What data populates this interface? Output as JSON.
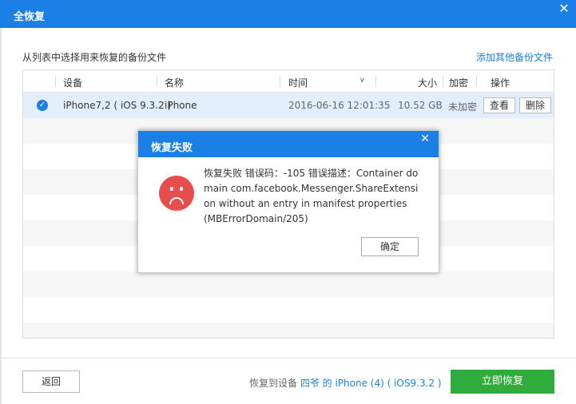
{
  "window": {
    "title": "全恢复",
    "close_glyph": "✕"
  },
  "subtitle": "从列表中选择用来恢复的备份文件",
  "add_link": "添加其他备份文件",
  "table": {
    "headers": {
      "device": "设备",
      "name": "名称",
      "time": "时间",
      "size": "大小",
      "encrypt": "加密",
      "action": "操作"
    },
    "rows": [
      {
        "device": "iPhone7,2 ( iOS 9.3.2 )",
        "name": "iPhone",
        "time": "2016-06-16 12:01:35",
        "size": "10.52 GB",
        "encrypt": "未加密",
        "view_label": "查看",
        "delete_label": "删除",
        "selected": true
      }
    ]
  },
  "footer": {
    "back_label": "返回",
    "restore_to_label": "恢复到设备",
    "device_label": "四爷 的 iPhone (4)  ( iOS9.3.2 )",
    "restore_now_label": "立即恢复"
  },
  "dialog": {
    "title": "恢复失败",
    "close_glyph": "✕",
    "message": "恢复失败 错误码：-105 错误描述：Container domain com.facebook.Messenger.ShareExtension without an entry in manifest properties (MBErrorDomain/205)",
    "ok_label": "确定"
  },
  "colors": {
    "accent": "#1a80e5",
    "confirm": "#2fac3b",
    "error": "#e84d4d"
  }
}
